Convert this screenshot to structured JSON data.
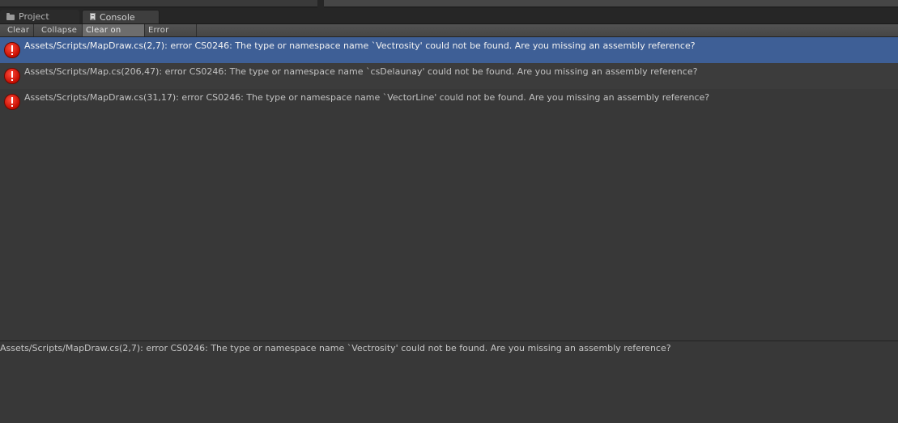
{
  "tabs": {
    "project_label": "Project",
    "console_label": "Console"
  },
  "toolbar": {
    "clear_label": "Clear",
    "collapse_label": "Collapse",
    "clear_on_play_label": "Clear on Play",
    "error_pause_label": "Error Pause"
  },
  "log_entries": [
    {
      "message": "Assets/Scripts/MapDraw.cs(2,7): error CS0246: The type or namespace name `Vectrosity' could not be found. Are you missing an assembly reference?",
      "icon": "error-icon"
    },
    {
      "message": "Assets/Scripts/Map.cs(206,47): error CS0246: The type or namespace name `csDelaunay' could not be found. Are you missing an assembly reference?",
      "icon": "error-icon"
    },
    {
      "message": "Assets/Scripts/MapDraw.cs(31,17): error CS0246: The type or namespace name `VectorLine' could not be found. Are you missing an assembly reference?",
      "icon": "error-icon"
    }
  ],
  "detail": {
    "text": "Assets/Scripts/MapDraw.cs(2,7): error CS0246: The type or namespace name `Vectrosity' could not be found. Are you missing an assembly reference?"
  },
  "colors": {
    "selection": "#3e5f96",
    "background": "#383838",
    "error": "#d81400"
  }
}
